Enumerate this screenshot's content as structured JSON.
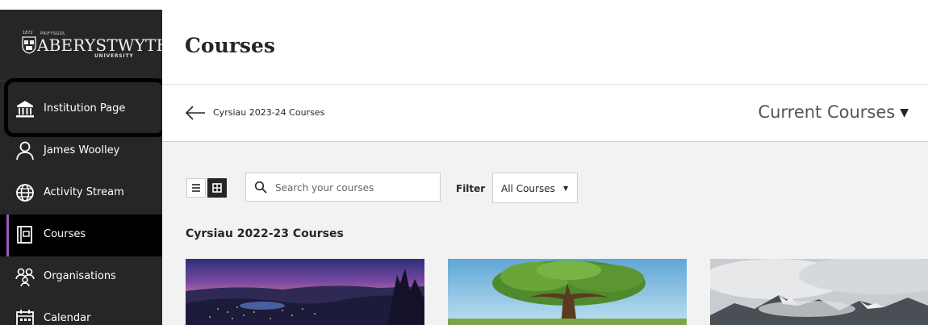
{
  "brand": {
    "year": "1872",
    "prefix": "PRIFYSGOL",
    "name": "ABERYSTWYTH",
    "sub": "UNIVERSITY"
  },
  "sidebar": {
    "items": [
      {
        "label": "Institution Page",
        "icon": "institution-icon"
      },
      {
        "label": "James Woolley",
        "icon": "user-icon"
      },
      {
        "label": "Activity Stream",
        "icon": "globe-icon"
      },
      {
        "label": "Courses",
        "icon": "courses-icon",
        "active": true
      },
      {
        "label": "Organisations",
        "icon": "organisations-icon"
      },
      {
        "label": "Calendar",
        "icon": "calendar-icon"
      }
    ]
  },
  "header": {
    "title": "Courses"
  },
  "subbar": {
    "breadcrumb": "Cyrsiau 2023-24 Courses",
    "term": "Current Courses"
  },
  "toolbar": {
    "search_placeholder": "Search your courses",
    "filter_label": "Filter",
    "filter_value": "All Courses"
  },
  "group": {
    "title": "Cyrsiau 2022-23 Courses"
  },
  "colors": {
    "sidebar": "#262626",
    "active_accent": "#9b59b6",
    "content_bg": "#f2f2f2"
  }
}
